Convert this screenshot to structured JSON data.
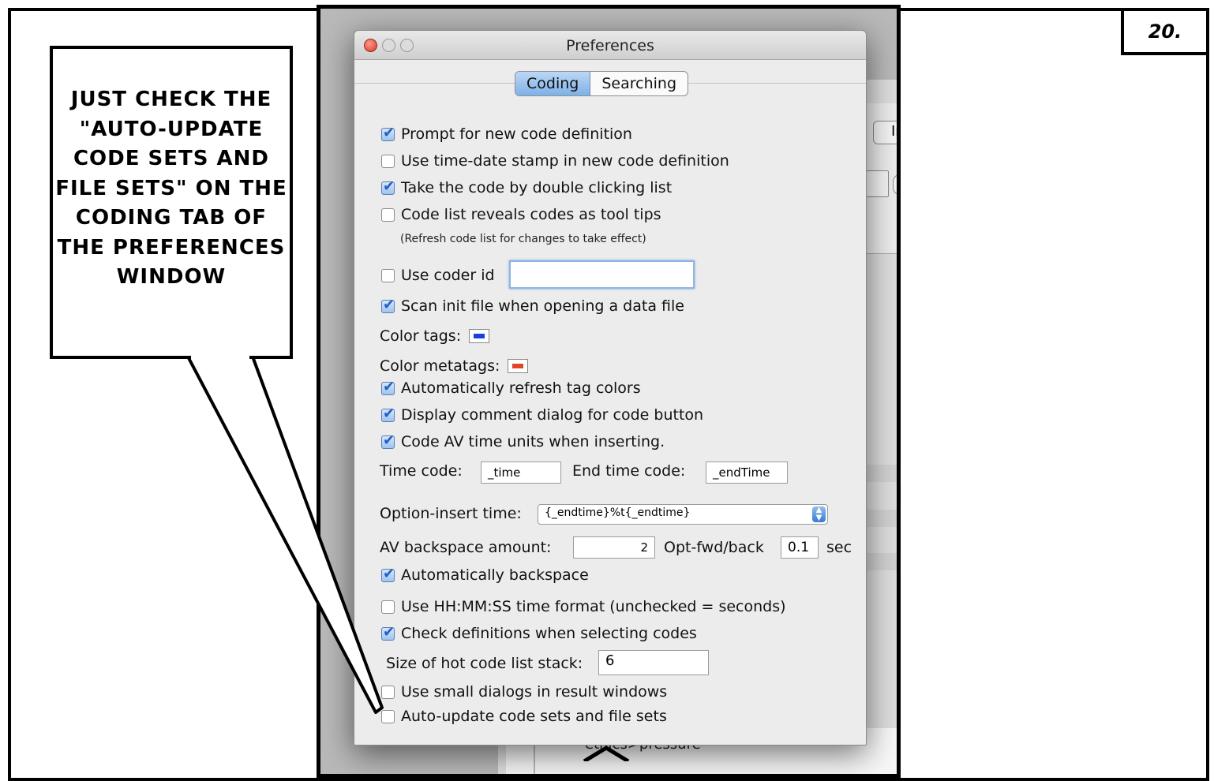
{
  "page_number": "20.",
  "caption": "Just check the \"Auto-update code sets and file sets\" on the Coding tab of the Preferences window",
  "background_window": {
    "button_fragment": "Ir",
    "list_text": "ethics>pressure"
  },
  "prefs": {
    "title": "Preferences",
    "tabs": [
      "Coding",
      "Searching"
    ],
    "selected_tab": "Coding",
    "options": {
      "prompt_new_code": {
        "label": "Prompt for new code definition",
        "checked": true
      },
      "time_date_stamp": {
        "label": "Use time-date stamp in new code definition",
        "checked": false
      },
      "take_code_double_click": {
        "label": "Take the code by double clicking list",
        "checked": true
      },
      "code_list_tooltips": {
        "label": "Code list reveals codes as tool tips",
        "checked": false
      },
      "refresh_note": "(Refresh code list for changes to take effect)",
      "use_coder_id": {
        "label": "Use coder id",
        "checked": false,
        "value": ""
      },
      "scan_init_file": {
        "label": "Scan init file when opening a data file",
        "checked": true
      },
      "color_tags": {
        "label": "Color tags:",
        "color": "#1a3fe0"
      },
      "color_metatags": {
        "label": "Color metatags:",
        "color": "#e0452a"
      },
      "auto_refresh_tag_colors": {
        "label": "Automatically refresh tag colors",
        "checked": true
      },
      "display_comment_dialog": {
        "label": "Display comment dialog for code button",
        "checked": true
      },
      "code_av_time_units": {
        "label": "Code AV time units when inserting.",
        "checked": true
      },
      "time_code": {
        "label": "Time code:",
        "value": "_time"
      },
      "end_time_code": {
        "label": "End time code:",
        "value": "_endTime"
      },
      "option_insert_time": {
        "label": "Option-insert time:",
        "value": "{_endtime}%t{_endtime}"
      },
      "av_backspace": {
        "label": "AV backspace amount:",
        "value": "2"
      },
      "opt_fwd_back": {
        "label": "Opt-fwd/back",
        "value": "0.1",
        "unit": "sec"
      },
      "auto_backspace": {
        "label": "Automatically backspace",
        "checked": true
      },
      "hhmmss_format": {
        "label": "Use HH:MM:SS time format (unchecked = seconds)",
        "checked": false
      },
      "check_definitions": {
        "label": "Check definitions when selecting codes",
        "checked": true
      },
      "hot_code_stack": {
        "label": "Size of hot code list stack:",
        "value": "6"
      },
      "small_dialogs": {
        "label": "Use small dialogs in result windows",
        "checked": false
      },
      "auto_update_sets": {
        "label": "Auto-update code sets and file sets",
        "checked": false
      }
    }
  }
}
